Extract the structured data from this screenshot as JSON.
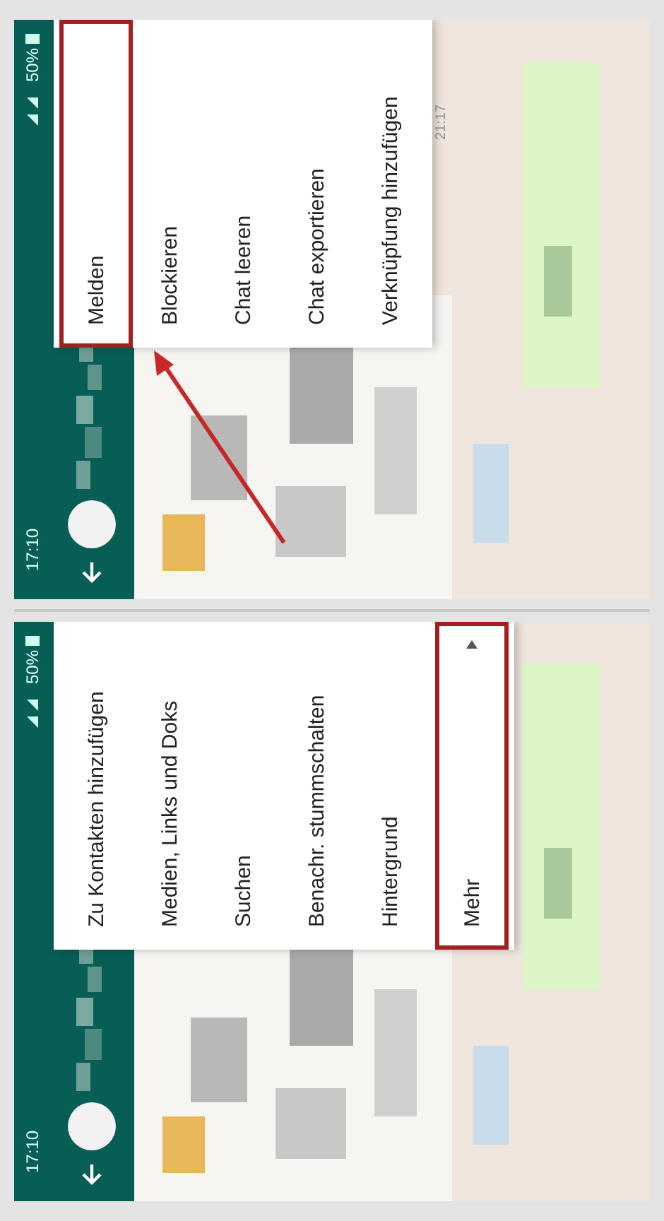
{
  "phones": [
    {
      "status_bar": {
        "time": "17:10",
        "battery": "50%"
      },
      "arrow": false,
      "menu": {
        "items": [
          {
            "label": "Zu Kontakten hinzufügen",
            "kind": "plain",
            "highlighted": false
          },
          {
            "label": "Medien, Links und Doks",
            "kind": "plain",
            "highlighted": false
          },
          {
            "label": "Suchen",
            "kind": "plain",
            "highlighted": false
          },
          {
            "label": "Benachr. stummschalten",
            "kind": "plain",
            "highlighted": false
          },
          {
            "label": "Hintergrund",
            "kind": "plain",
            "highlighted": false
          },
          {
            "label": "Mehr",
            "kind": "submenu",
            "highlighted": true
          }
        ]
      }
    },
    {
      "status_bar": {
        "time": "17:10",
        "battery": "50%"
      },
      "timestamp": "21:17",
      "arrow": true,
      "menu": {
        "items": [
          {
            "label": "Melden",
            "kind": "plain",
            "highlighted": true
          },
          {
            "label": "Blockieren",
            "kind": "plain",
            "highlighted": false
          },
          {
            "label": "Chat leeren",
            "kind": "plain",
            "highlighted": false
          },
          {
            "label": "Chat exportieren",
            "kind": "plain",
            "highlighted": false
          },
          {
            "label": "Verknüpfung hinzufügen",
            "kind": "plain",
            "highlighted": false
          }
        ]
      }
    }
  ]
}
